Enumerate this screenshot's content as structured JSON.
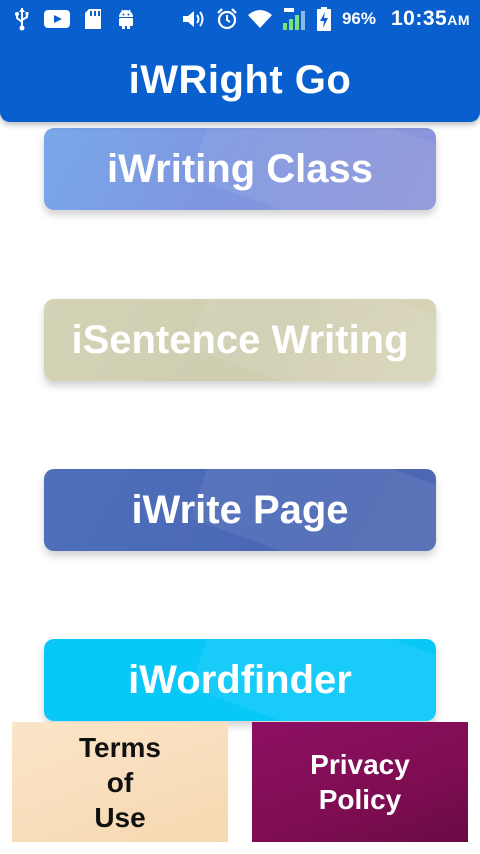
{
  "status_bar": {
    "icons_left": [
      "usb-icon",
      "youtube-icon",
      "sd-card-icon",
      "android-icon"
    ],
    "icons_right": [
      "volume-icon",
      "alarm-icon",
      "wifi-icon",
      "signal-icon",
      "battery-charging-icon"
    ],
    "battery_percent": "96%",
    "time": "10:35",
    "ampm": "AM"
  },
  "app_bar": {
    "title": "iWRight Go"
  },
  "menu": {
    "writing_class": "iWriting Class",
    "sentence_writing": "iSentence Writing",
    "write_page": "iWrite Page",
    "wordfinder": "iWordfinder"
  },
  "footer": {
    "terms": "Terms\nof\nUse",
    "privacy": "Privacy\nPolicy"
  },
  "colors": {
    "primary": "#0a5fcf",
    "writing_class": "#7e96e0",
    "sentence_writing": "#d3d1b4",
    "write_page": "#4c6bb7",
    "wordfinder": "#08c8f8",
    "terms_bg": "#f8dfbb",
    "privacy_bg": "#7e0d52"
  }
}
